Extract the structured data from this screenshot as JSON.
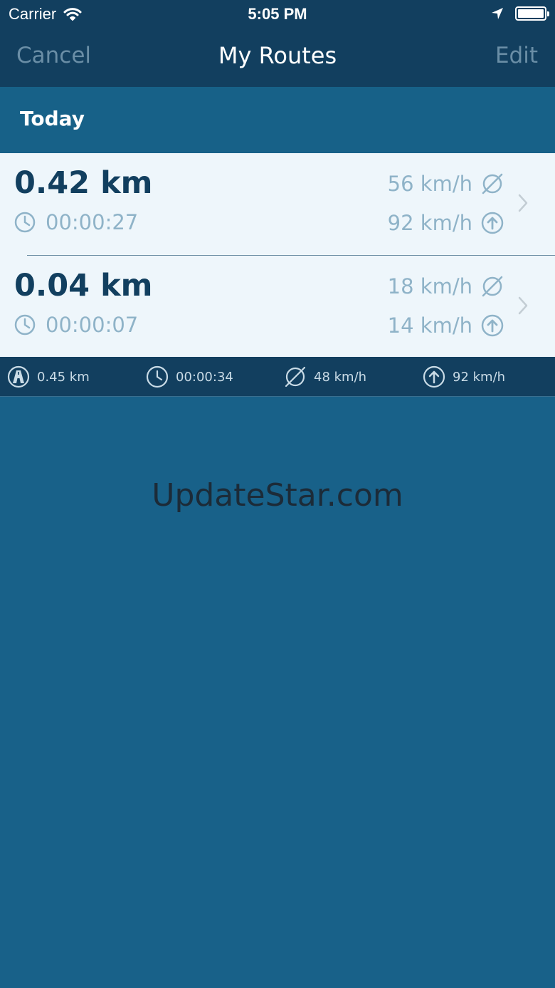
{
  "status_bar": {
    "carrier": "Carrier",
    "time": "5:05 PM",
    "icons": [
      "wifi-icon",
      "location-arrow-icon",
      "battery-icon"
    ]
  },
  "nav": {
    "cancel_label": "Cancel",
    "title": "My Routes",
    "edit_label": "Edit"
  },
  "section": {
    "title": "Today"
  },
  "routes": [
    {
      "distance": "0.42 km",
      "duration": "00:00:27",
      "avg_speed": "56 km/h",
      "max_speed": "92 km/h"
    },
    {
      "distance": "0.04 km",
      "duration": "00:00:07",
      "avg_speed": "18 km/h",
      "max_speed": "14 km/h"
    }
  ],
  "summary": {
    "distance": "0.45 km",
    "duration": "00:00:34",
    "avg_speed": "48 km/h",
    "max_speed": "92 km/h"
  },
  "watermark": "UpdateStar.com",
  "colors": {
    "nav_background": "#123f5f",
    "content_background": "#186189",
    "row_background": "#eef6fb",
    "primary_text": "#123f5f",
    "secondary_text": "#8fb3c8"
  }
}
